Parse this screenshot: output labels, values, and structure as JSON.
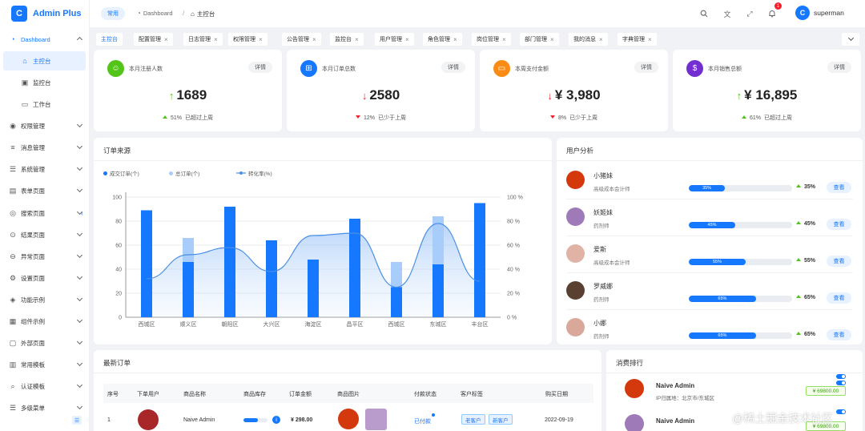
{
  "app": {
    "name": "Admin Plus",
    "logo_letter": "C"
  },
  "sidebar": {
    "items": [
      {
        "label": "Dashboard",
        "icon": "dashboard-icon",
        "expanded": true
      },
      {
        "label": "主控台",
        "icon": "home-icon",
        "active": true
      },
      {
        "label": "监控台",
        "icon": "monitor-icon"
      },
      {
        "label": "工作台",
        "icon": "desktop-icon"
      },
      {
        "label": "权限管理",
        "icon": "lock-icon"
      },
      {
        "label": "消息管理",
        "icon": "message-icon"
      },
      {
        "label": "系统管理",
        "icon": "settings-sliders-icon"
      },
      {
        "label": "表单页面",
        "icon": "form-icon"
      },
      {
        "label": "搜索页面",
        "icon": "search-page-icon"
      },
      {
        "label": "结果页面",
        "icon": "result-icon"
      },
      {
        "label": "异常页面",
        "icon": "error-icon"
      },
      {
        "label": "设置页面",
        "icon": "gear-icon"
      },
      {
        "label": "功能示例",
        "icon": "feature-icon"
      },
      {
        "label": "组件示例",
        "icon": "component-icon"
      },
      {
        "label": "外部页面",
        "icon": "external-icon"
      },
      {
        "label": "常用模板",
        "icon": "template-icon"
      },
      {
        "label": "认证模板",
        "icon": "auth-icon"
      },
      {
        "label": "多级菜单",
        "icon": "multilevel-icon"
      }
    ]
  },
  "header": {
    "tag": "常用",
    "breadcrumb": [
      {
        "label": "Dashboard"
      },
      {
        "label": "主控台"
      }
    ],
    "notification_count": "1",
    "avatar_letter": "C",
    "username": "superman"
  },
  "tabs": [
    {
      "label": "主控台",
      "active": true,
      "closable": false
    },
    {
      "label": "配置管理",
      "closable": true
    },
    {
      "label": "日志管理",
      "closable": true
    },
    {
      "label": "权限管理",
      "closable": true
    },
    {
      "label": "公告管理",
      "closable": true
    },
    {
      "label": "监控台",
      "closable": true
    },
    {
      "label": "用户管理",
      "closable": true
    },
    {
      "label": "角色管理",
      "closable": true
    },
    {
      "label": "岗位管理",
      "closable": true
    },
    {
      "label": "部门管理",
      "closable": true
    },
    {
      "label": "我的消息",
      "closable": true
    },
    {
      "label": "字典管理",
      "closable": true
    }
  ],
  "tab_close_glyph": "×",
  "stats": [
    {
      "label": "本月注册人数",
      "detail": "详情",
      "value": "1689",
      "trend": "up",
      "foot_pct": "51%",
      "foot_text": "已超过上周",
      "color": "#52c41a"
    },
    {
      "label": "本月订单总数",
      "detail": "详情",
      "value": "2580",
      "trend": "down",
      "foot_pct": "12%",
      "foot_text": "已少于上周",
      "color": "#1677ff"
    },
    {
      "label": "本周支付金额",
      "detail": "详情",
      "value": "¥ 3,980",
      "trend": "down",
      "foot_pct": "8%",
      "foot_text": "已少于上周",
      "color": "#fa8c16"
    },
    {
      "label": "本月销售总额",
      "detail": "详情",
      "value": "¥ 16,895",
      "trend": "up",
      "foot_pct": "61%",
      "foot_text": "已超过上周",
      "color": "#722ed1"
    }
  ],
  "orders_chart": {
    "title": "订单来源"
  },
  "chart_data": {
    "type": "bar",
    "categories": [
      "西城区",
      "顺义区",
      "朝阳区",
      "大兴区",
      "海淀区",
      "昌平区",
      "西城区",
      "东城区",
      "丰台区"
    ],
    "series": [
      {
        "name": "成交订单(个)",
        "type": "bar",
        "values": [
          89,
          46,
          92,
          64,
          48,
          82,
          25,
          44,
          95
        ]
      },
      {
        "name": "总订单(个)",
        "type": "bar",
        "values": [
          89,
          66,
          92,
          64,
          48,
          82,
          46,
          84,
          95
        ]
      },
      {
        "name": "转化率(%)",
        "type": "line",
        "axis": "right",
        "values": [
          32,
          52,
          58,
          38,
          68,
          70,
          25,
          78,
          30
        ]
      }
    ],
    "y_ticks_left": [
      "0",
      "20",
      "40",
      "60",
      "80",
      "100"
    ],
    "y_ticks_right": [
      "0 %",
      "20 %",
      "40 %",
      "60 %",
      "80 %",
      "100 %"
    ],
    "ylim": [
      0,
      100
    ],
    "ylim_right": [
      0,
      100
    ],
    "grid": true,
    "legend": "top-left",
    "colors": {
      "deal": "#1677ff",
      "total": "#a9cdfb",
      "rate": "#4a8fe7"
    }
  },
  "user_analysis": {
    "title": "用户分析",
    "button_label": "查看",
    "users": [
      {
        "name": "小猪妹",
        "role": "高级成本会计师",
        "percent": 35,
        "percent_label": "35%",
        "avatar_color": "#d4380d"
      },
      {
        "name": "妖姬妹",
        "role": "药剂师",
        "percent": 45,
        "percent_label": "45%",
        "avatar_color": "#9e7ab8"
      },
      {
        "name": "爱斯",
        "role": "高级成本会计师",
        "percent": 55,
        "percent_label": "55%",
        "avatar_color": "#e0b3a6"
      },
      {
        "name": "罗威娜",
        "role": "药剂师",
        "percent": 65,
        "percent_label": "65%",
        "avatar_color": "#5a4030"
      },
      {
        "name": "小娜",
        "role": "药剂师",
        "percent": 65,
        "percent_label": "65%",
        "avatar_color": "#d9a89a"
      }
    ]
  },
  "latest_orders": {
    "title": "最新订单",
    "columns": [
      "序号",
      "下单用户",
      "商品名称",
      "商品库存",
      "订单金额",
      "商品图片",
      "付款状态",
      "客户标签",
      "购买日期"
    ],
    "rows": [
      {
        "index": "1",
        "product": "Naive Admin",
        "stock_percent": 60,
        "amount": "¥ 298.00",
        "status": "已付款",
        "tags": [
          "老客户",
          "新客户"
        ],
        "date": "2022-09-19"
      }
    ]
  },
  "ranking": {
    "title": "消费排行",
    "items": [
      {
        "name": "Naive Admin",
        "ip": "IP归属地：北京市/东城区",
        "amount": "¥ 69800.00"
      },
      {
        "name": "Naive Admin",
        "ip": "",
        "amount": "¥ 69800.00"
      }
    ]
  },
  "watermark": "@稀土掘金技术社区"
}
